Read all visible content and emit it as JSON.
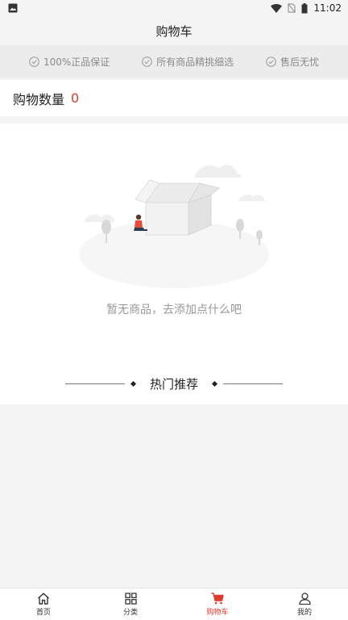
{
  "status_bar": {
    "time": "11:02",
    "icons": [
      "image-icon",
      "wifi-icon",
      "no-sim-icon",
      "battery-icon"
    ]
  },
  "header": {
    "title": "购物车"
  },
  "guarantees": [
    {
      "label": "100%正品保证",
      "icon": "check-circle-icon"
    },
    {
      "label": "所有商品精挑细选",
      "icon": "check-circle-icon"
    },
    {
      "label": "售后无忧",
      "icon": "check-circle-icon"
    }
  ],
  "cart": {
    "count_label": "购物数量",
    "count": "0"
  },
  "empty_state": {
    "message": "暂无商品，去添加点什么吧"
  },
  "recommend": {
    "title": "热门推荐"
  },
  "bottom_nav": {
    "items": [
      {
        "label": "首页",
        "icon": "home-icon",
        "active": false
      },
      {
        "label": "分类",
        "icon": "grid-icon",
        "active": false
      },
      {
        "label": "购物车",
        "icon": "cart-icon",
        "active": true
      },
      {
        "label": "我的",
        "icon": "user-icon",
        "active": false
      }
    ]
  },
  "colors": {
    "accent": "#e13a2c",
    "background": "#f4f4f4",
    "guarantee_bar": "#ececec"
  }
}
